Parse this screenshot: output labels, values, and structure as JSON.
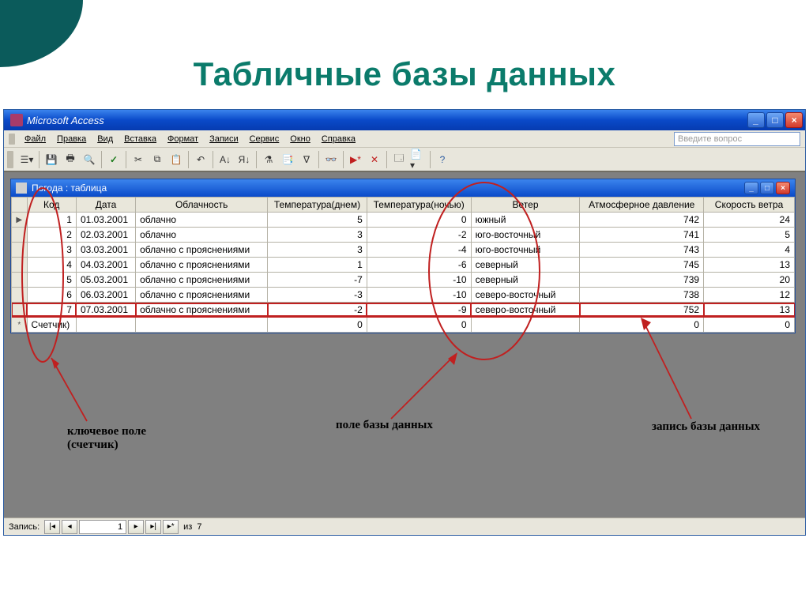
{
  "slide": {
    "title": "Табличные базы данных"
  },
  "app": {
    "title": "Microsoft Access",
    "search_placeholder": "Введите вопрос"
  },
  "menu": {
    "items": [
      "Файл",
      "Правка",
      "Вид",
      "Вставка",
      "Формат",
      "Записи",
      "Сервис",
      "Окно",
      "Справка"
    ]
  },
  "doc": {
    "title": "Погода : таблица"
  },
  "table": {
    "columns": [
      "Код",
      "Дата",
      "Облачность",
      "Температура(днем)",
      "Температура(ночью)",
      "Ветер",
      "Атмосферное давление",
      "Скорость ветра"
    ],
    "rows": [
      {
        "marker": "▶",
        "code": "1",
        "date": "01.03.2001",
        "cloud": "облачно",
        "tday": "5",
        "tnight": "0",
        "wind": "южный",
        "press": "742",
        "wspeed": "24"
      },
      {
        "marker": "",
        "code": "2",
        "date": "02.03.2001",
        "cloud": "облачно",
        "tday": "3",
        "tnight": "-2",
        "wind": "юго-восточный",
        "press": "741",
        "wspeed": "5"
      },
      {
        "marker": "",
        "code": "3",
        "date": "03.03.2001",
        "cloud": "облачно с прояснениями",
        "tday": "3",
        "tnight": "-4",
        "wind": "юго-восточный",
        "press": "743",
        "wspeed": "4"
      },
      {
        "marker": "",
        "code": "4",
        "date": "04.03.2001",
        "cloud": "облачно с прояснениями",
        "tday": "1",
        "tnight": "-6",
        "wind": "северный",
        "press": "745",
        "wspeed": "13"
      },
      {
        "marker": "",
        "code": "5",
        "date": "05.03.2001",
        "cloud": "облачно с прояснениями",
        "tday": "-7",
        "tnight": "-10",
        "wind": "северный",
        "press": "739",
        "wspeed": "20"
      },
      {
        "marker": "",
        "code": "6",
        "date": "06.03.2001",
        "cloud": "облачно с прояснениями",
        "tday": "-3",
        "tnight": "-10",
        "wind": "северо-восточный",
        "press": "738",
        "wspeed": "12"
      },
      {
        "marker": "",
        "code": "7",
        "date": "07.03.2001",
        "cloud": "облачно с прояснениями",
        "tday": "-2",
        "tnight": "-9",
        "wind": "северо-восточный",
        "press": "752",
        "wspeed": "13",
        "highlight": true
      }
    ],
    "newrow": {
      "marker": "*",
      "code": "Счетчик)",
      "date": "",
      "cloud": "",
      "tday": "0",
      "tnight": "0",
      "wind": "",
      "press": "0",
      "wspeed": "0"
    }
  },
  "annotations": {
    "key_field": "ключевое поле (счетчик)",
    "db_field": "поле базы данных",
    "db_record": "запись базы данных"
  },
  "nav": {
    "label": "Запись:",
    "current": "1",
    "of": "из",
    "total": "7"
  }
}
